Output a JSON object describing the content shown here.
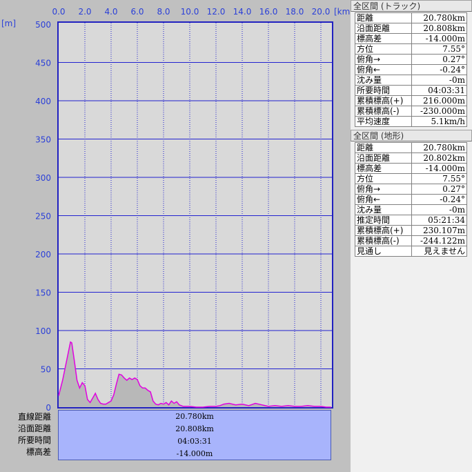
{
  "chart_data": {
    "type": "area",
    "x_unit": "[km]",
    "y_unit": "[m]",
    "x_ticks": [
      "0.0",
      "2.0",
      "4.0",
      "6.0",
      "8.0",
      "10.0",
      "12.0",
      "14.0",
      "16.0",
      "18.0",
      "20.0"
    ],
    "y_ticks": [
      "0",
      "50",
      "100",
      "150",
      "200",
      "250",
      "300",
      "350",
      "400",
      "450",
      "500"
    ],
    "xlim": [
      0,
      20.78
    ],
    "ylim": [
      0,
      500
    ],
    "grid": true,
    "series": [
      {
        "color": "#e000e0",
        "x": [
          0,
          0.3,
          0.6,
          0.9,
          1.0,
          1.2,
          1.4,
          1.6,
          1.8,
          2.0,
          2.2,
          2.4,
          2.6,
          2.8,
          3.0,
          3.2,
          3.4,
          3.6,
          3.8,
          4.0,
          4.2,
          4.4,
          4.6,
          4.8,
          5.0,
          5.2,
          5.4,
          5.6,
          5.8,
          6.0,
          6.2,
          6.4,
          6.6,
          6.8,
          7.0,
          7.2,
          7.4,
          7.6,
          7.8,
          8.0,
          8.2,
          8.4,
          8.6,
          8.8,
          9.0,
          9.2,
          9.5,
          10.0,
          10.5,
          11.0,
          11.5,
          12.0,
          12.3,
          12.6,
          13.0,
          13.5,
          14.0,
          14.5,
          15.0,
          15.5,
          16.0,
          16.5,
          17.0,
          17.5,
          18.0,
          18.5,
          19.0,
          19.5,
          20.0,
          20.4,
          20.78
        ],
        "y": [
          15,
          35,
          60,
          85,
          84,
          60,
          35,
          25,
          32,
          28,
          10,
          6,
          12,
          18,
          10,
          5,
          4,
          4,
          6,
          8,
          16,
          30,
          43,
          42,
          38,
          35,
          38,
          36,
          38,
          36,
          28,
          25,
          25,
          22,
          20,
          8,
          4,
          3,
          5,
          4,
          6,
          3,
          8,
          5,
          7,
          3,
          1,
          1,
          0,
          0,
          1,
          1,
          2,
          4,
          5,
          3,
          4,
          2,
          5,
          3,
          1,
          2,
          1,
          2,
          1,
          1,
          2,
          1,
          1,
          0,
          0
        ]
      }
    ]
  },
  "summary": {
    "labels": [
      "直線距離",
      "沿面距離",
      "所要時間",
      "標高差"
    ],
    "values": [
      "20.780km",
      "20.808km",
      "04:03:31",
      "-14.000m"
    ]
  },
  "track_section": {
    "title": "全区間 (トラック)",
    "rows": [
      {
        "label": "距離",
        "value": "20.780km"
      },
      {
        "label": "沿面距離",
        "value": "20.808km"
      },
      {
        "label": "標高差",
        "value": "-14.000m"
      },
      {
        "label": "方位",
        "value": "7.55°"
      },
      {
        "label": "俯角→",
        "value": "0.27°"
      },
      {
        "label": "俯角←",
        "value": "-0.24°"
      },
      {
        "label": "沈み量",
        "value": "-0m"
      },
      {
        "label": "所要時間",
        "value": "04:03:31"
      },
      {
        "label": "累積標高(+)",
        "value": "216.000m"
      },
      {
        "label": "累積標高(-)",
        "value": "-230.000m"
      },
      {
        "label": "平均速度",
        "value": "5.1km/h"
      }
    ]
  },
  "terrain_section": {
    "title": "全区間 (地形)",
    "rows": [
      {
        "label": "距離",
        "value": "20.780km"
      },
      {
        "label": "沿面距離",
        "value": "20.802km"
      },
      {
        "label": "標高差",
        "value": "-14.000m"
      },
      {
        "label": "方位",
        "value": "7.55°"
      },
      {
        "label": "俯角→",
        "value": "0.27°"
      },
      {
        "label": "俯角←",
        "value": "-0.24°"
      },
      {
        "label": "沈み量",
        "value": "-0m"
      },
      {
        "label": "推定時間",
        "value": "05:21:34"
      },
      {
        "label": "累積標高(+)",
        "value": "230.107m"
      },
      {
        "label": "累積標高(-)",
        "value": "-244.122m"
      },
      {
        "label": "見通し",
        "value": "見えません"
      }
    ]
  }
}
